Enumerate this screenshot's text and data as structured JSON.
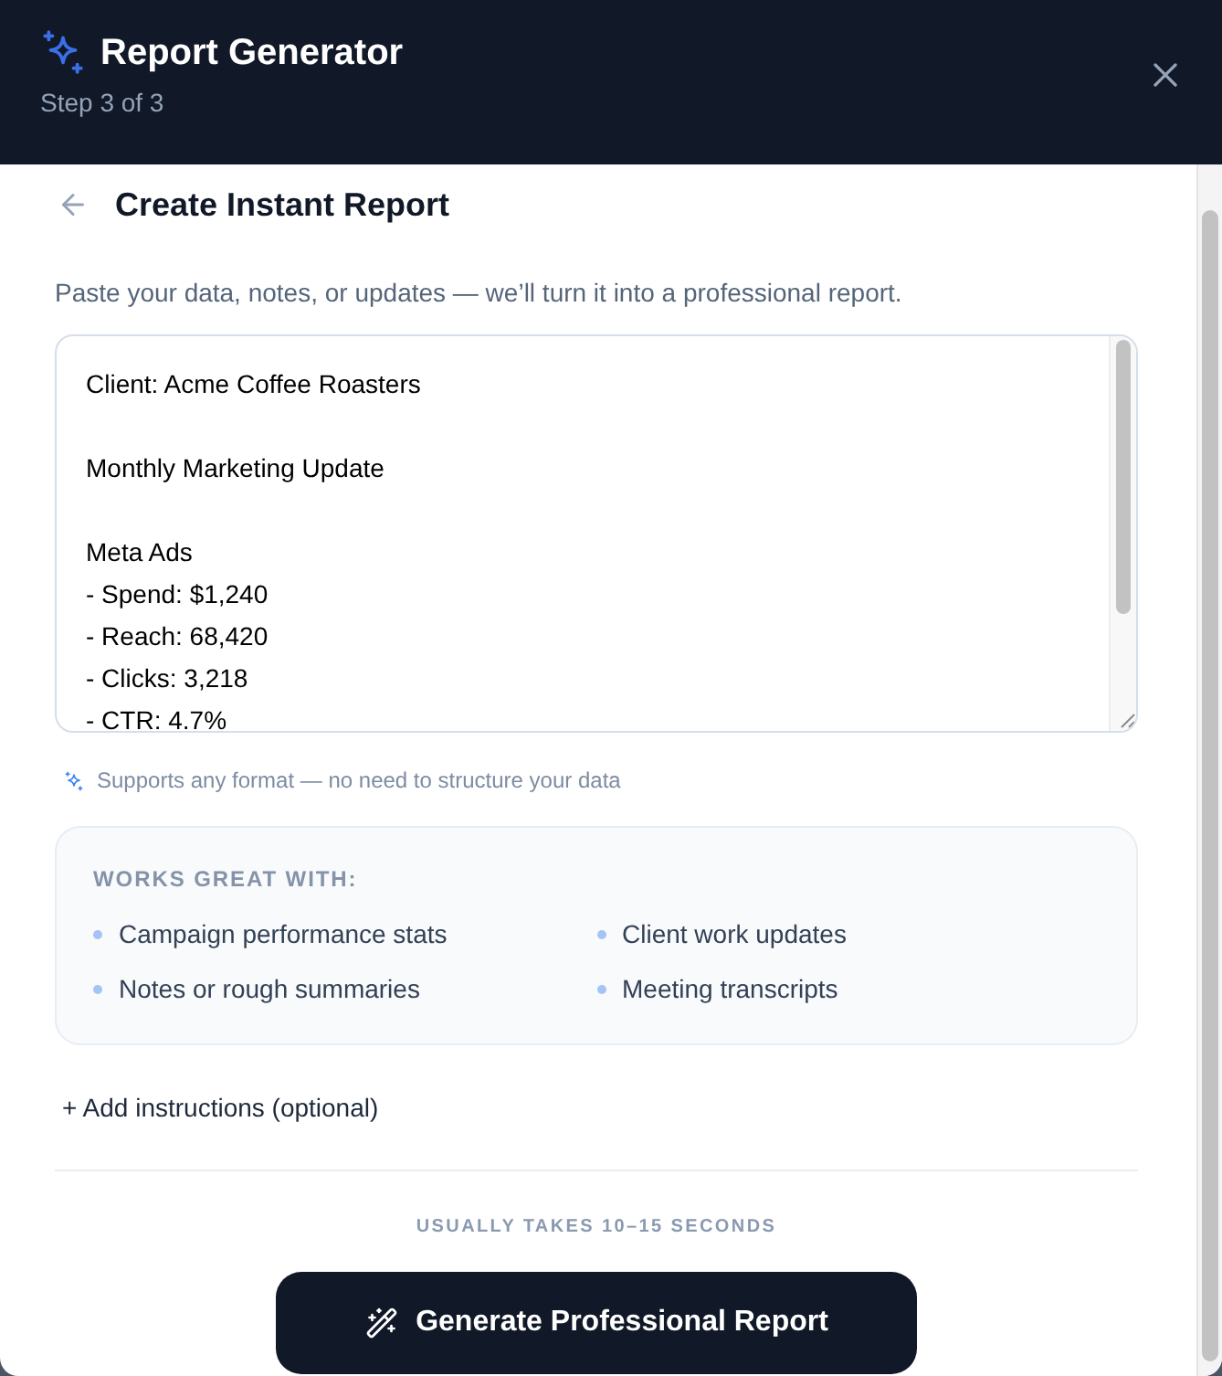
{
  "header": {
    "title": "Report Generator",
    "subtitle": "Step 3 of 3"
  },
  "page": {
    "title": "Create Instant Report",
    "description": "Paste your data, notes, or updates — we’ll turn it into a professional report."
  },
  "data_field": {
    "value": "Client: Acme Coffee Roasters\n\nMonthly Marketing Update\n\nMeta Ads\n- Spend: $1,240\n- Reach: 68,420\n- Clicks: 3,218\n- CTR: 4.7%"
  },
  "hint": "Supports any format — no need to structure your data",
  "works_with": {
    "heading": "WORKS GREAT WITH:",
    "items": [
      "Campaign performance stats",
      "Client work updates",
      "Notes or rough summaries",
      "Meeting transcripts"
    ]
  },
  "add_instructions": "+ Add instructions (optional)",
  "timing_note": "USUALLY TAKES 10–15 SECONDS",
  "generate_button": "Generate Professional Report"
}
